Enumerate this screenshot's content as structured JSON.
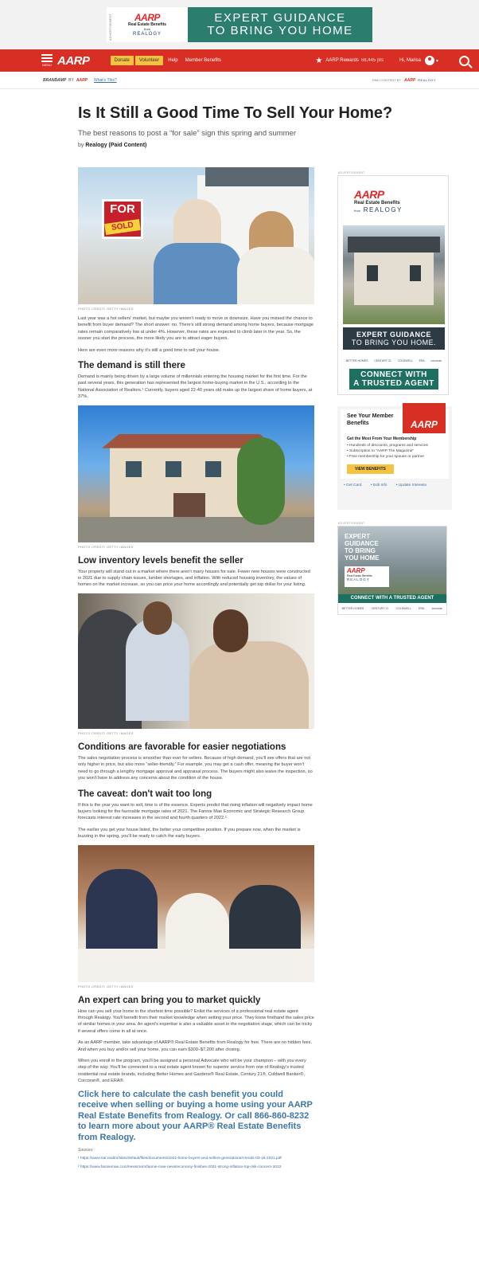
{
  "top_ad": {
    "advertisement_tag": "ADVERTISEMENT",
    "logo": "AARP",
    "program": "Real Estate Benefits",
    "from": "from",
    "partner": "REALOGY",
    "line1": "EXPERT GUIDANCE",
    "line2": "TO BRING YOU HOME"
  },
  "nav": {
    "menu_label": "MENU",
    "logo": "AARP",
    "donate": "Donate",
    "volunteer": "Volunteer",
    "help": "Help",
    "member_benefits": "Member Benefits",
    "rewards": "AARP Rewards",
    "rewards_points": "68,445 pts",
    "greeting": "Hi, Marisa"
  },
  "brand_row": {
    "brandamp": "BRANDAMP",
    "by": "BY",
    "aarp": "AARP",
    "whats_this": "What's This?",
    "paid_content_by": "PAID CONTENT BY",
    "paid_aarp": "AARP",
    "paid_program": "REALOGY"
  },
  "article": {
    "title": "Is It Still a Good Time To Sell Your Home?",
    "subtitle": "The best reasons to post a “for sale” sign this spring and summer",
    "by": "by",
    "author": "Realogy (Paid Content)",
    "photo_credit": "PHOTO CREDIT: GETTY IMAGES",
    "sign_for": "FOR",
    "sign_sold": "SOLD",
    "p1": "Last year was a hot sellers' market, but maybe you weren't ready to move or downsize. Have you missed the chance to benefit from buyer demand? The short answer: no. There's still strong demand among home buyers, because mortgage rates remain comparatively low at under 4%. However, these rates are expected to climb later in the year. So, the sooner you start the process, the more likely you are to attract eager buyers.",
    "p2": "Here are even more reasons why it's still a good time to sell your house.",
    "h_demand": "The demand is still there",
    "p3": "Demand is mainly being driven by a large volume of millennials entering the housing market for the first time. For the past several years, this generation has represented the largest home-buying market in the U.S., according to the National Association of Realtors.¹ Currently, buyers aged 22-40 years old make up the largest share of home buyers, at 37%.",
    "h_inventory": "Low inventory levels benefit the seller",
    "p4": "Your property will stand out in a market where there aren't many houses for sale. Fewer new houses were constructed in 2021 due to supply chain issues, lumber shortages, and inflation. With reduced housing inventory, the values of homes on the market increase, so you can price your home accordingly and potentially get top dollar for your listing.",
    "h_conditions": "Conditions are favorable for easier negotiations",
    "p5": "The sales negotiation process is smoother than ever for sellers. Because of high demand, you'll see offers that are not only higher in price, but also more “seller-friendly.” For example, you may get a cash offer, meaning the buyer won't need to go through a lengthy mortgage approval and appraisal process. The buyers might also waive the inspection, so you won't have to address any concerns about the condition of the house.",
    "h_caveat": "The caveat: don't wait too long",
    "p6": "If this is the year you want to sell, time is of the essence. Experts predict that rising inflation will negatively impact home buyers looking for the favorable mortgage rates of 2021. The Fannie Mae Economic and Strategic Research Group forecasts interest rate increases in the second and fourth quarters of 2022.²",
    "p7": "The earlier you get your house listed, the better your competitive position. If you prepare now, when the market is buzzing in the spring, you'll be ready to catch the early buyers.",
    "h_expert": "An expert can bring you to market quickly",
    "p8": "How can you sell your home in the shortest time possible? Enlist the services of a professional real estate agent through Realogy. You'll benefit from their market knowledge when setting your price. They know firsthand the sales price of similar homes in your area. An agent's expertise is also a valuable asset in the negotiation stage, which can be tricky if several offers come in all at once.",
    "p9": "As an AARP member, take advantage of AARP® Real Estate Benefits from Realogy for free. There are no hidden fees. And when you buy and/or sell your home, you can earn $300–$7,200 after closing.",
    "p10": "When you enroll in the program, you'll be assigned a personal Advocate who will be your champion – with you every step of the way. You'll be connected to a real estate agent known for superior service from one of Realogy's trusted residential real estate brands, including Better Homes and Gardens® Real Estate, Century 21®, Coldwell Banker®, Corcoran®, and ERA®.",
    "cta": "Click here to calculate the cash benefit you could receive when selling or buying a home using your AARP Real Estate Benefits from Realogy. Or call 866-860-8232 to learn more about your AARP® Real Estate Benefits from Realogy.",
    "sources_label": "Sources:",
    "source1": "¹ https://www.nar.realtor/sites/default/files/documents/2021-home-buyers-and-sellers-generational-trends-03-16-2021.pdf",
    "source2": "² https://www.fanniemae.com/newsroom/fannie-mae-news/economy-finishes-2021-strong-inflation-top-risk-concern-2022"
  },
  "sidebar": {
    "ad1": {
      "tag": "ADVERTISEMENT",
      "logo": "AARP",
      "program": "Real Estate Benefits",
      "from": "from",
      "partner": "REALOGY",
      "line1": "EXPERT GUIDANCE",
      "line2": "TO BRING YOU HOME.",
      "brands": [
        "BETTER HOMES",
        "CENTURY 21",
        "COLDWELL",
        "ERA",
        "corcoran"
      ],
      "connect1": "CONNECT WITH",
      "connect2": "A TRUSTED AGENT"
    },
    "member": {
      "title": "See Your Member Benefits",
      "card": "AARP",
      "get_most": "Get the Most From Your Membership",
      "items": [
        "Hundreds of discounts, programs and services",
        "Subscription to \"AARP The Magazine\"",
        "Free membership for your spouse or partner"
      ],
      "view_benefits": "VIEW BENEFITS",
      "link_card": "Get Card",
      "link_edit": "Edit Info",
      "link_interests": "Update Interests"
    },
    "ad2": {
      "tag": "ADVERTISEMENT",
      "line1": "EXPERT",
      "line2": "GUIDANCE",
      "line3": "TO BRING",
      "line4": "YOU HOME",
      "logo": "AARP",
      "program": "Real Estate Benefits",
      "partner": "REALOGY",
      "connect": "CONNECT WITH A TRUSTED AGENT",
      "brands": [
        "BETTER HOMES",
        "CENTURY 21",
        "COLDWELL",
        "ERA",
        "corcoran"
      ]
    }
  },
  "colors": {
    "nav_red": "#d82e23",
    "aarp_red": "#e4272c",
    "banner_green": "#2b7e6d",
    "link_blue": "#3c76a8",
    "button_yellow": "#f5c242"
  }
}
